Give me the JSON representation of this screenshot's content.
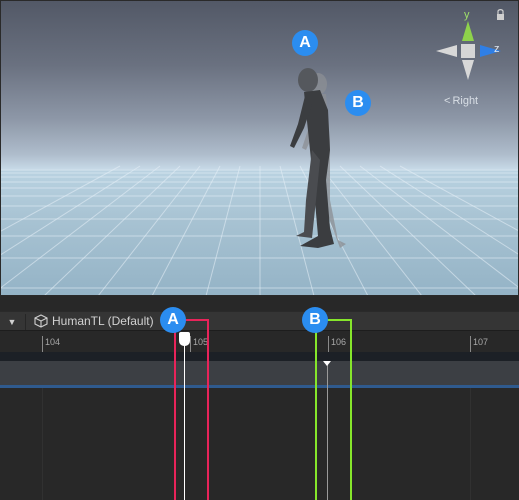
{
  "scene": {
    "callout_a": "A",
    "callout_b": "B",
    "gizmo": {
      "y_label": "y",
      "z_label": "z",
      "view_label": "Right",
      "colors": {
        "y": "#8ed24b",
        "z": "#2f7fe6",
        "x": "#d8d8d8"
      }
    }
  },
  "timeline": {
    "asset_name": "HumanTL (Default)",
    "ruler_labels": [
      "104",
      "105",
      "106",
      "107"
    ],
    "callout_a": "A",
    "callout_b": "B",
    "colors": {
      "bracket_a": "#e8245a",
      "bracket_b": "#86e62b",
      "callout": "#2b8df0",
      "track_line": "#2f5a8e"
    }
  }
}
